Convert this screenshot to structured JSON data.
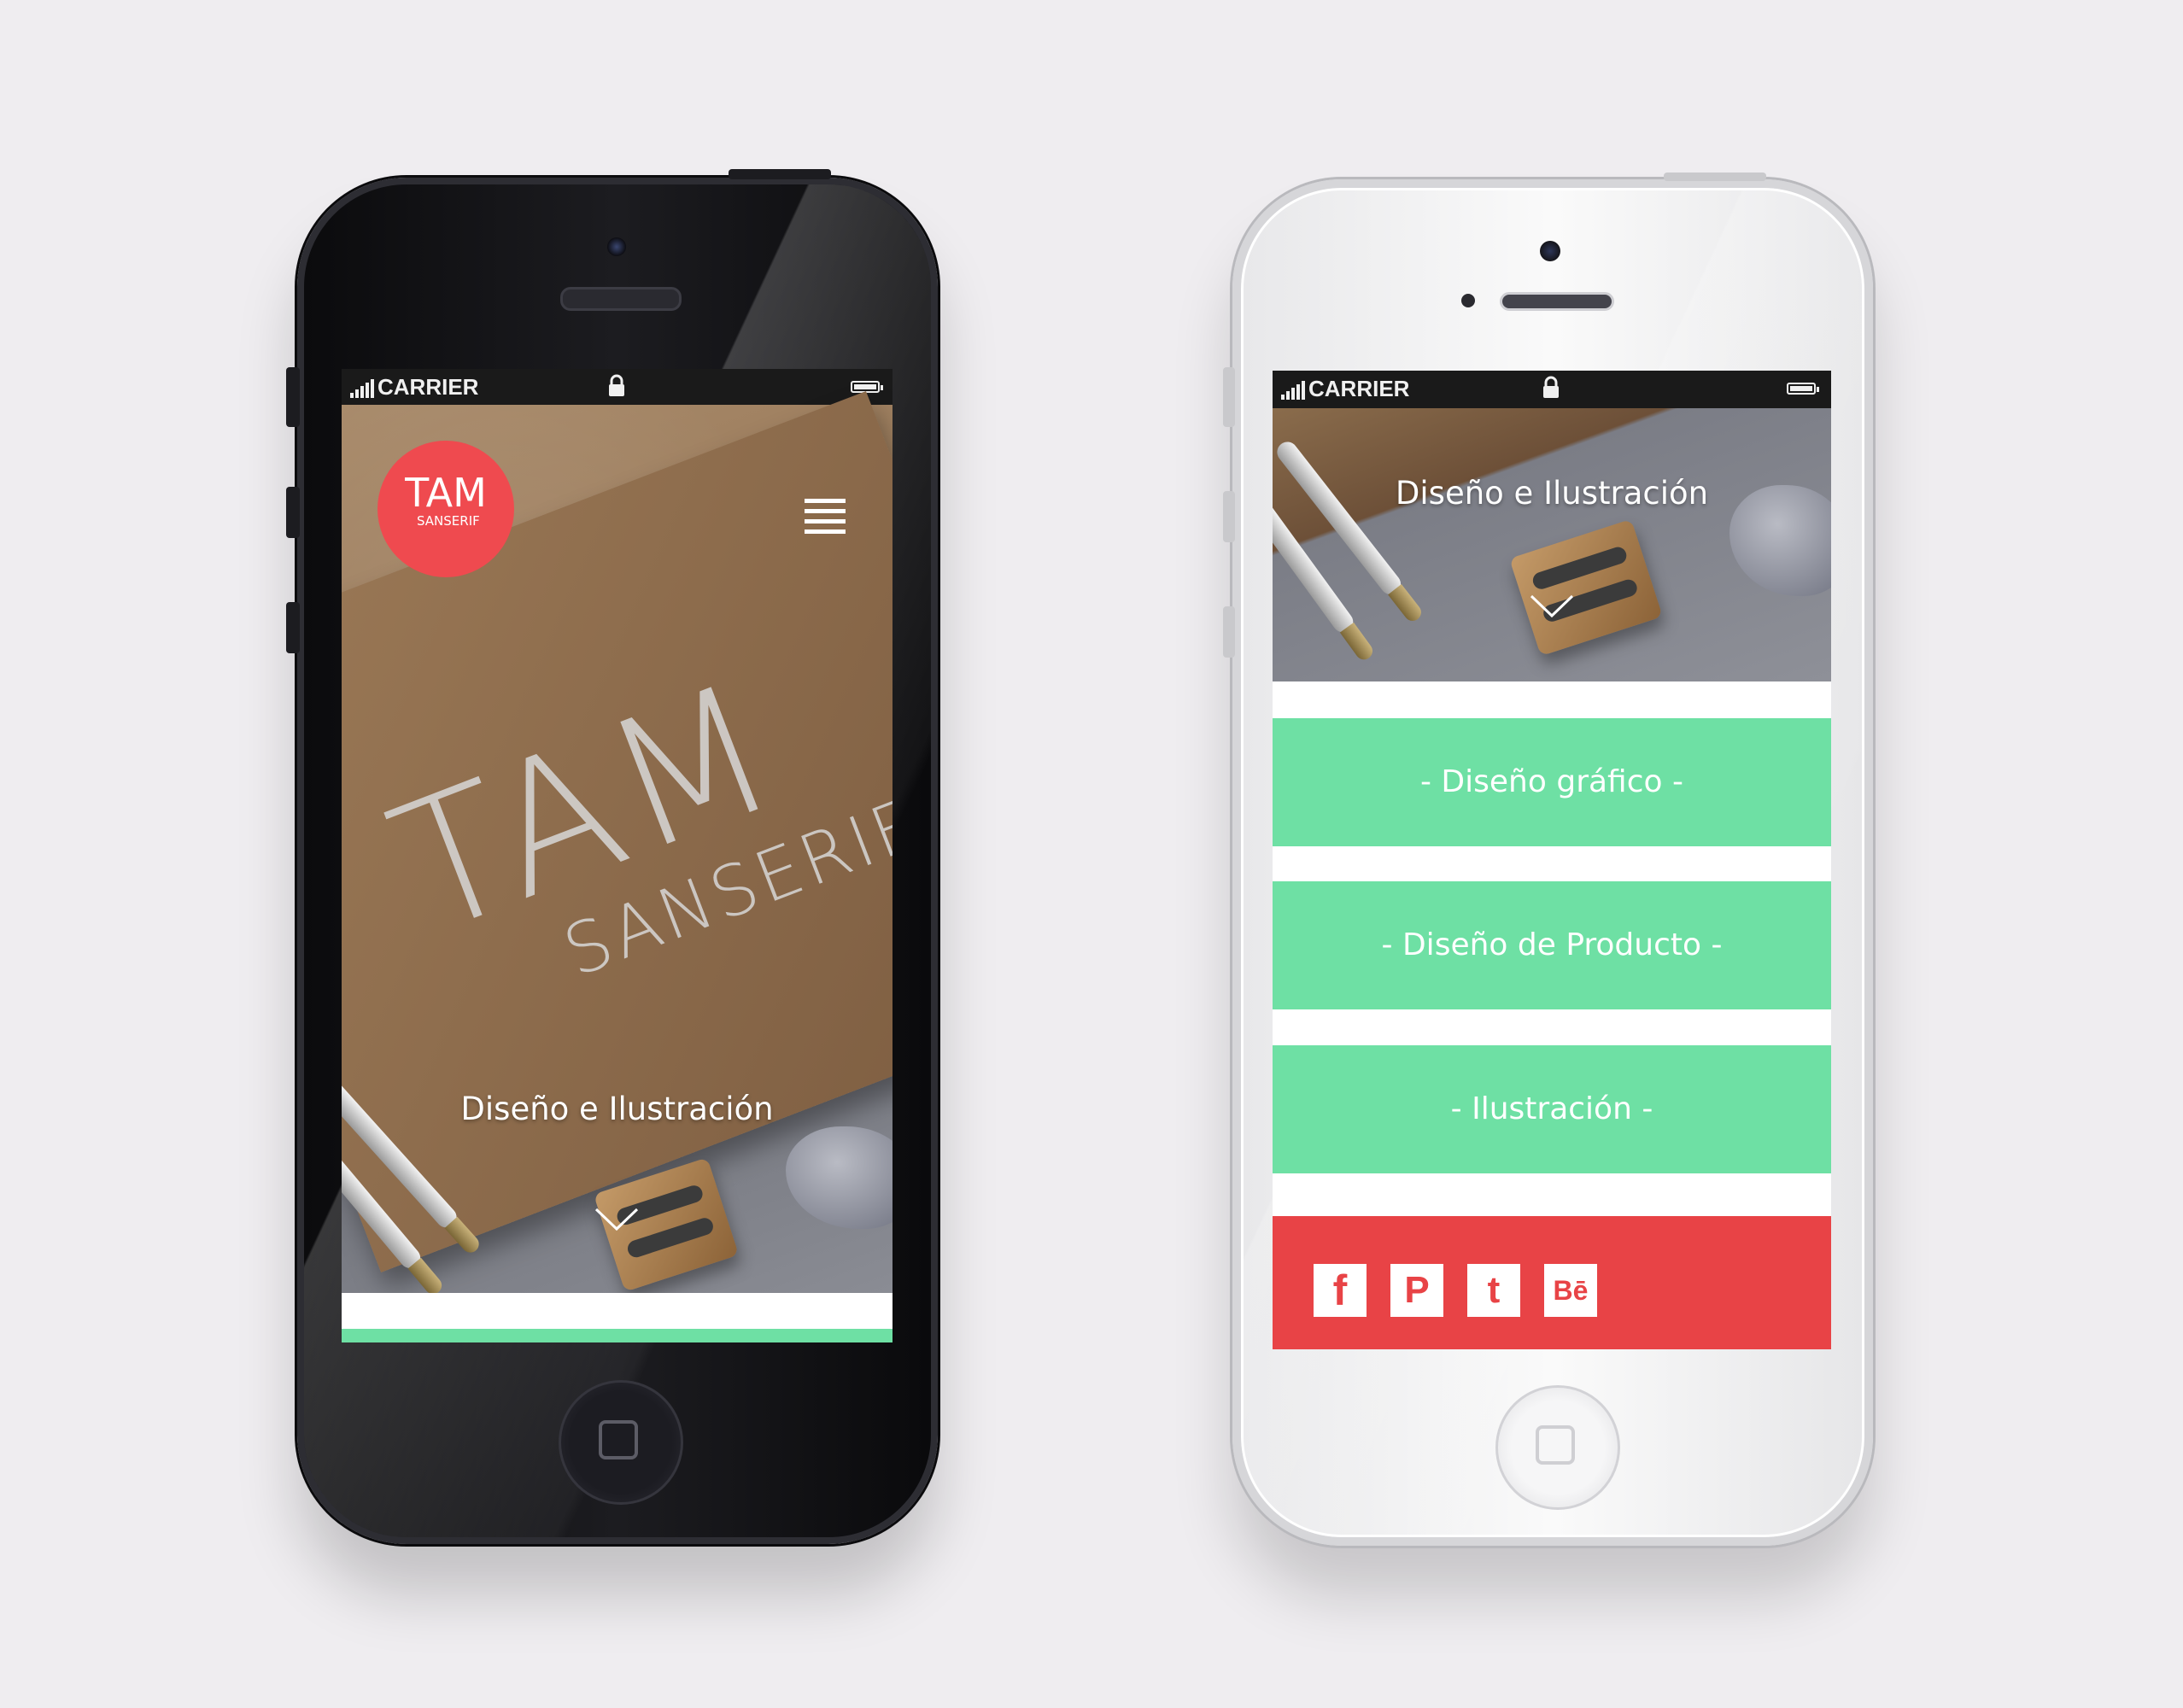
{
  "statusbar": {
    "carrier": "CARRIER",
    "lock_icon": "lock-icon",
    "battery_icon": "battery-icon",
    "signal_icon": "signal-bars-icon"
  },
  "left_phone": {
    "logo": {
      "line1": "TAM",
      "line2": "SANSERIF"
    },
    "hero_wordmark": {
      "line1": "TAM",
      "line2": "SANSERIF"
    },
    "menu_icon": "hamburger-menu-icon",
    "headline": "Diseño e Ilustración",
    "scroll_icon": "chevron-down-icon"
  },
  "right_phone": {
    "headline": "Diseño e Ilustración",
    "scroll_icon": "chevron-down-icon",
    "menu_items": [
      {
        "label": "- Diseño gráfico -"
      },
      {
        "label": "- Diseño de Producto -"
      },
      {
        "label": "- Ilustración -"
      }
    ],
    "social": [
      {
        "icon": "facebook-icon",
        "glyph": "f"
      },
      {
        "icon": "pinterest-icon",
        "glyph": "P"
      },
      {
        "icon": "twitter-icon",
        "glyph": "t"
      },
      {
        "icon": "behance-icon",
        "glyph": "Bē"
      }
    ]
  },
  "colors": {
    "accent_green": "#6ee0a4",
    "accent_red": "#e84346",
    "logo_red": "#ef4a4f",
    "background": "#efedf0"
  }
}
